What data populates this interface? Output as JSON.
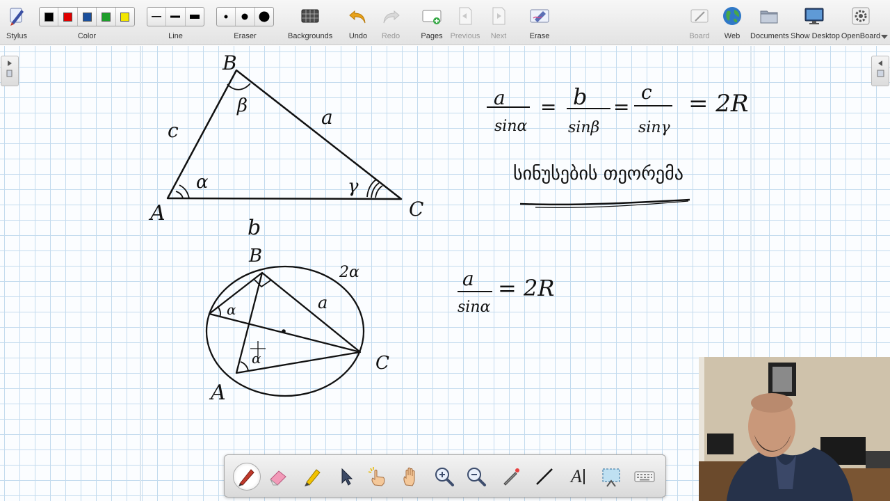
{
  "toolbar": {
    "items": [
      {
        "id": "stylus",
        "label": "Stylus",
        "icon": "stylus-icon"
      },
      {
        "id": "color",
        "label": "Color"
      },
      {
        "id": "line",
        "label": "Line"
      },
      {
        "id": "eraser",
        "label": "Eraser"
      },
      {
        "id": "backgrounds",
        "label": "Backgrounds",
        "icon": "backgrounds-icon"
      },
      {
        "id": "undo",
        "label": "Undo",
        "icon": "undo-icon"
      },
      {
        "id": "redo",
        "label": "Redo",
        "icon": "redo-icon",
        "disabled": true
      },
      {
        "id": "pages",
        "label": "Pages",
        "icon": "pages-icon"
      },
      {
        "id": "previous",
        "label": "Previous",
        "icon": "previous-page-icon",
        "disabled": true
      },
      {
        "id": "next",
        "label": "Next",
        "icon": "next-page-icon",
        "disabled": true
      },
      {
        "id": "erase",
        "label": "Erase",
        "icon": "erase-page-icon"
      },
      {
        "id": "board",
        "label": "Board",
        "icon": "board-icon",
        "disabled": true
      },
      {
        "id": "web",
        "label": "Web",
        "icon": "web-globe-icon"
      },
      {
        "id": "documents",
        "label": "Documents",
        "icon": "documents-folder-icon"
      },
      {
        "id": "show_desktop",
        "label": "Show Desktop",
        "icon": "desktop-monitor-icon"
      },
      {
        "id": "openboard",
        "label": "OpenBoard",
        "icon": "settings-gear-icon"
      }
    ],
    "colors": [
      "#000000",
      "#e00000",
      "#1a4f9c",
      "#1e9e2a",
      "#f2e600"
    ],
    "selected_color": "#000000"
  },
  "board": {
    "triangle": {
      "vertex_labels": [
        "B",
        "A",
        "C"
      ],
      "side_labels": [
        "c",
        "a",
        "b"
      ],
      "angle_labels": [
        "β",
        "α",
        "γ"
      ]
    },
    "law_of_sines": {
      "fractions": [
        {
          "num": "a",
          "den": "sinα"
        },
        {
          "num": "b",
          "den": "sinβ"
        },
        {
          "num": "c",
          "den": "sinγ"
        }
      ],
      "equals": "=",
      "result": "= 2R",
      "caption": "სინუსების თეორემა"
    },
    "circle_figure": {
      "vertex_labels": [
        "B",
        "A",
        "C"
      ],
      "side_label": "a",
      "arc_label": "2α",
      "angle_labels": [
        "α",
        "α"
      ]
    },
    "proof": {
      "num": "a",
      "den": "sinα",
      "result": "= 2R"
    }
  },
  "floating_tools": [
    {
      "icon": "pen-icon",
      "active": true
    },
    {
      "icon": "eraser-icon"
    },
    {
      "icon": "highlighter-icon"
    },
    {
      "icon": "selector-arrow-icon"
    },
    {
      "icon": "interact-hand-icon"
    },
    {
      "icon": "hand-pan-icon"
    },
    {
      "icon": "zoom-in-icon"
    },
    {
      "icon": "zoom-out-icon"
    },
    {
      "icon": "laser-pointer-icon"
    },
    {
      "icon": "draw-line-icon"
    },
    {
      "icon": "text-tool-icon",
      "text": "A"
    },
    {
      "icon": "capture-area-icon"
    },
    {
      "icon": "virtual-keyboard-icon"
    }
  ]
}
